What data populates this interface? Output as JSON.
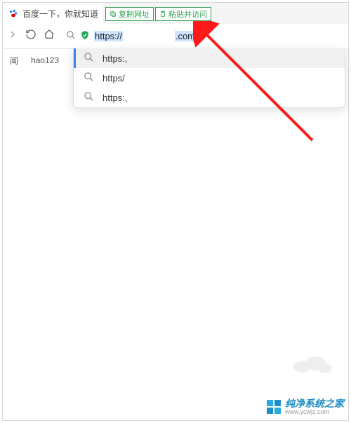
{
  "tab": {
    "title": "百度一下，你就知道"
  },
  "context": {
    "copy_url": "复制网址",
    "paste_visit": "粘贴并访问"
  },
  "bookmarks": {
    "item1": "闻",
    "item2": "hao123"
  },
  "address": {
    "prefix": "https://",
    "suffix": ".com"
  },
  "suggestions": [
    {
      "text": "https:,"
    },
    {
      "text": "https/"
    },
    {
      "text": "https:,"
    }
  ],
  "watermark": {
    "title": "纯净系统之家",
    "url": "www.ycwjz.com"
  }
}
